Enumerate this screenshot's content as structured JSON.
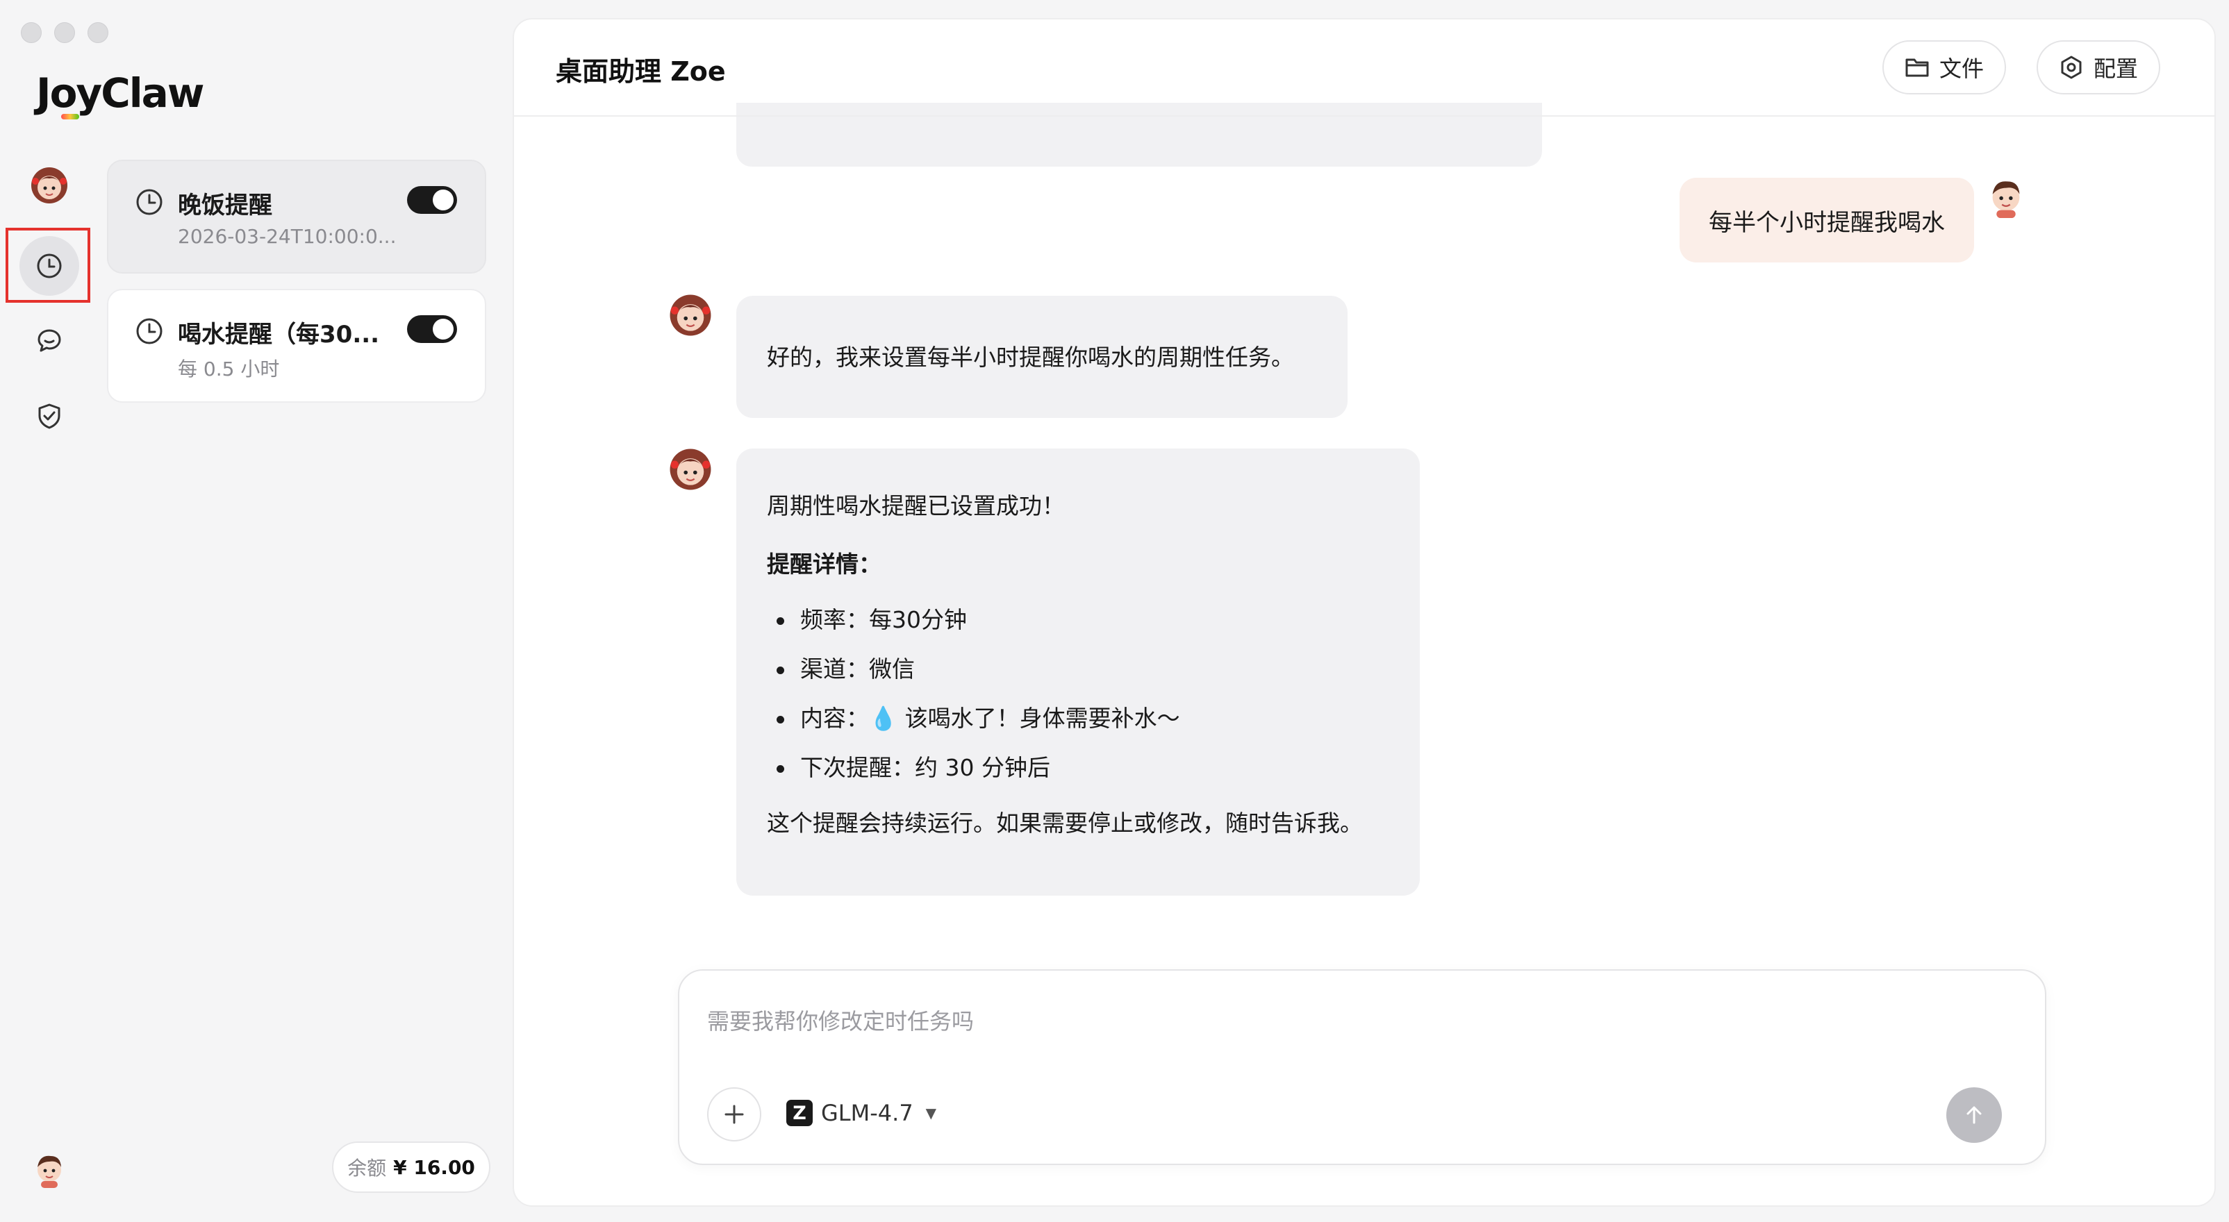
{
  "app": {
    "logo": "JoyClaw"
  },
  "tasks": [
    {
      "title": "晚饭提醒",
      "subtitle": "2026-03-24T10:00:0...",
      "enabled": true,
      "selected": true
    },
    {
      "title": "喝水提醒（每30...",
      "subtitle": "每 0.5 小时",
      "enabled": true,
      "selected": false
    }
  ],
  "balance": {
    "label": "余额",
    "amount": "¥ 16.00"
  },
  "header": {
    "title": "桌面助理 Zoe",
    "files_label": "文件",
    "config_label": "配置"
  },
  "chat": {
    "user_message": "每半个小时提醒我喝水",
    "bot_reply_1": "好的，我来设置每半小时提醒你喝水的周期性任务。",
    "bot_reply_2": {
      "intro": "周期性喝水提醒已设置成功！",
      "details_heading": "提醒详情：",
      "items": [
        {
          "label": "频率：",
          "value": "每30分钟"
        },
        {
          "label": "渠道：",
          "value": "微信"
        },
        {
          "label": "内容：",
          "emoji": "💧",
          "value": "该喝水了！身体需要补水～"
        },
        {
          "label": "下次提醒：",
          "value": "约 30 分钟后"
        }
      ],
      "outro": "这个提醒会持续运行。如果需要停止或修改，随时告诉我。"
    }
  },
  "composer": {
    "placeholder": "需要我帮你修改定时任务吗",
    "model": "GLM-4.7",
    "model_badge": "Z"
  },
  "icons": {
    "assistant_avatar": "girl-avatar-icon",
    "user_avatar": "boy-avatar-icon",
    "tasks": "clock-icon",
    "chat": "chat-bubble-icon",
    "security": "shield-check-icon"
  },
  "colors": {
    "highlight": "#e5322d",
    "user_bubble": "#fbeee8",
    "bot_bubble": "#f1f1f3",
    "toggle_on": "#1a1a1a"
  }
}
